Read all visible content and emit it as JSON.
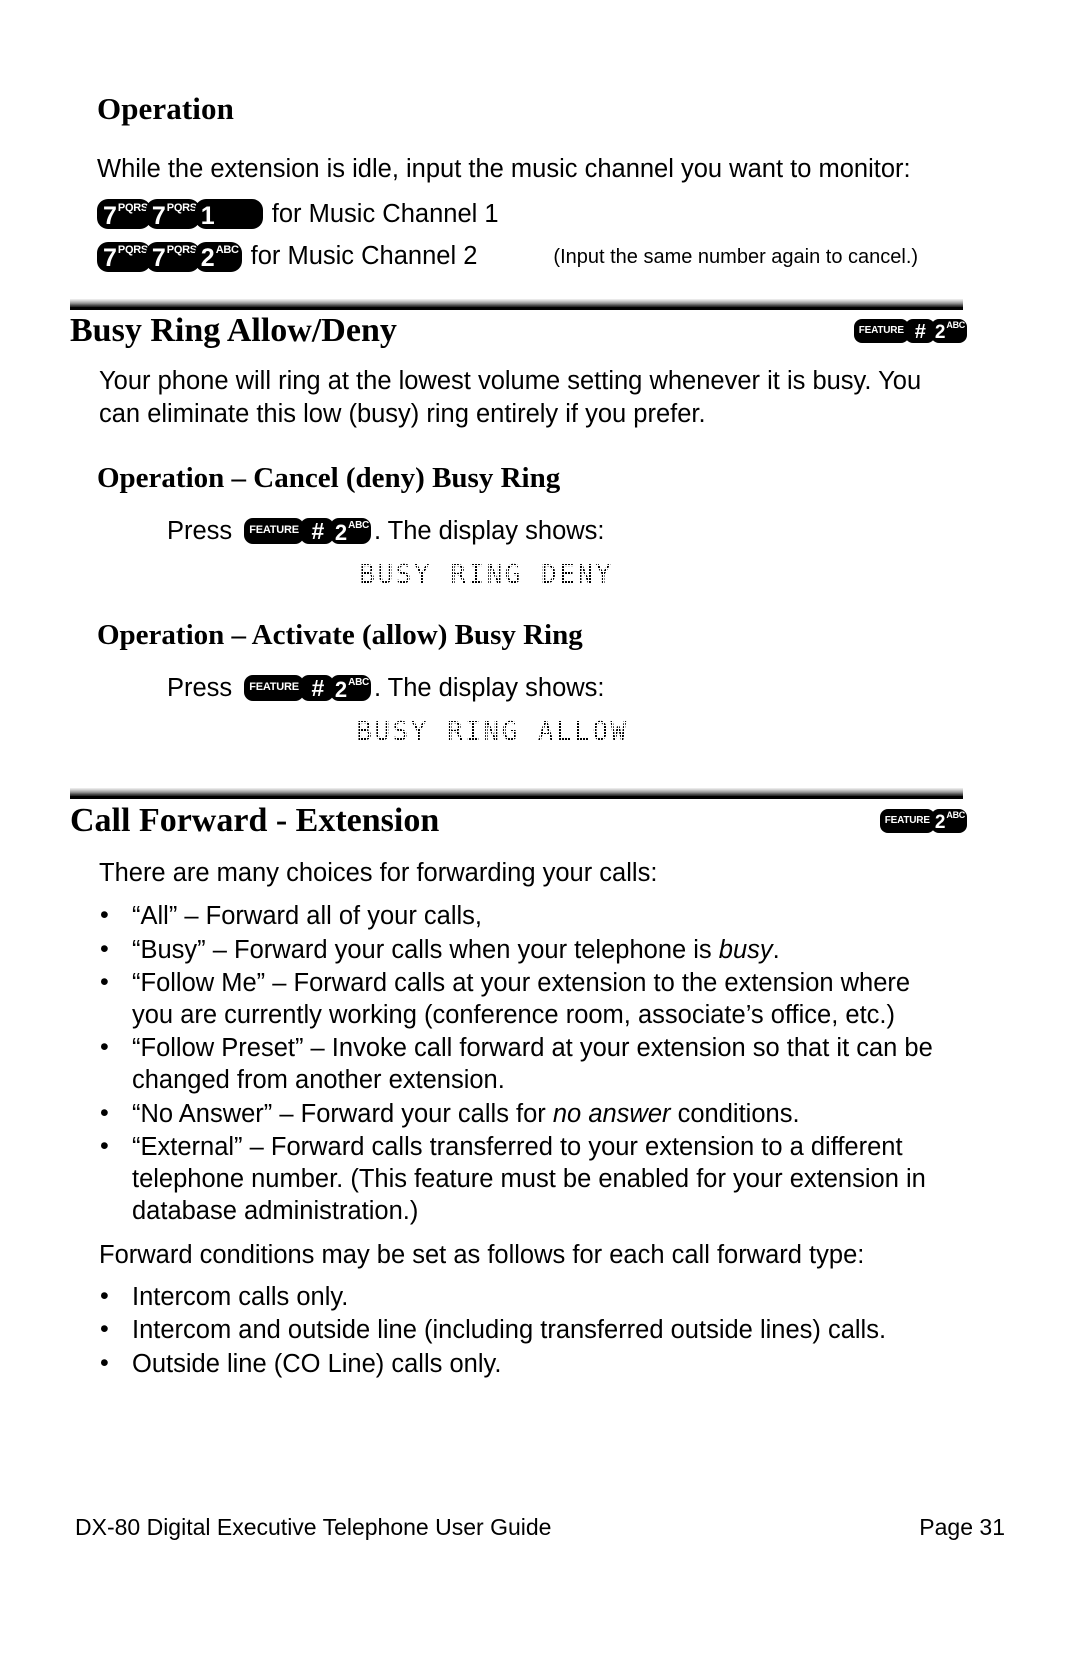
{
  "document": {
    "footer_left": "DX-80 Digital Executive Telephone User Guide",
    "footer_right": "Page 31"
  },
  "operation_music": {
    "heading": "Operation",
    "intro": "While the extension is idle, input the music channel you want to monitor:",
    "lines": [
      {
        "keys": [
          {
            "type": "digit",
            "digit": "7",
            "letters": "PQRS"
          },
          {
            "type": "digit",
            "digit": "7",
            "letters": "PQRS"
          },
          {
            "type": "digit",
            "digit": "1",
            "letters": ""
          }
        ],
        "text": "for Music Channel 1",
        "note": ""
      },
      {
        "keys": [
          {
            "type": "digit",
            "digit": "7",
            "letters": "PQRS"
          },
          {
            "type": "digit",
            "digit": "7",
            "letters": "PQRS"
          },
          {
            "type": "digit",
            "digit": "2",
            "letters": "ABC"
          }
        ],
        "text": "for Music Channel 2",
        "note": "(Input the same number again to cancel.)"
      }
    ]
  },
  "busy_ring": {
    "title": "Busy Ring Allow/Deny",
    "header_keys": [
      {
        "type": "feature",
        "label": "FEATURE"
      },
      {
        "type": "hash",
        "glyph": "#"
      },
      {
        "type": "digit",
        "digit": "2",
        "letters": "ABC"
      }
    ],
    "intro": "Your phone will ring at the lowest volume setting whenever it is busy. You can eliminate this low (busy) ring entirely if you prefer.",
    "subsections": [
      {
        "heading": "Operation – Cancel (deny) Busy Ring",
        "press_label": "Press",
        "keys": [
          {
            "type": "feature",
            "label": "FEATURE"
          },
          {
            "type": "hash",
            "glyph": "#"
          },
          {
            "type": "digit",
            "digit": "2",
            "letters": "ABC"
          }
        ],
        "after_keys": ". The display shows:",
        "display": "BUSY RING DENY"
      },
      {
        "heading": "Operation – Activate (allow) Busy Ring",
        "press_label": "Press",
        "keys": [
          {
            "type": "feature",
            "label": "FEATURE"
          },
          {
            "type": "hash",
            "glyph": "#"
          },
          {
            "type": "digit",
            "digit": "2",
            "letters": "ABC"
          }
        ],
        "after_keys": ". The display shows:",
        "display": "BUSY RING ALLOW"
      }
    ]
  },
  "call_forward": {
    "title": "Call Forward - Extension",
    "header_keys": [
      {
        "type": "feature",
        "label": "FEATURE"
      },
      {
        "type": "digit",
        "digit": "2",
        "letters": "ABC"
      }
    ],
    "intro": "There are many choices for forwarding your calls:",
    "choices": [
      {
        "pre": "“All” – Forward all of your calls,",
        "ital": "",
        "post": ""
      },
      {
        "pre": "“Busy” – Forward your calls when your telephone is ",
        "ital": "busy",
        "post": "."
      },
      {
        "pre": "“Follow Me” – Forward calls at your extension to the extension where you are currently working (conference room, associate’s office, etc.)",
        "ital": "",
        "post": ""
      },
      {
        "pre": "“Follow Preset” – Invoke call forward at your extension so that it can be changed from another extension.",
        "ital": "",
        "post": ""
      },
      {
        "pre": "“No Answer” – Forward your calls for ",
        "ital": "no answer",
        "post": " conditions."
      },
      {
        "pre": "“External” – Forward calls transferred to your extension to a different telephone number. (This feature must be enabled for your extension in database administration.)",
        "ital": "",
        "post": ""
      }
    ],
    "conditions_intro": "Forward conditions may be set as follows for each call forward type:",
    "conditions": [
      "Intercom calls only.",
      "Intercom and outside line (including transferred outside lines) calls.",
      "Outside line (CO Line) calls only."
    ]
  }
}
